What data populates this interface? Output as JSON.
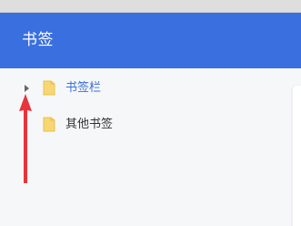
{
  "header": {
    "title": "书签"
  },
  "tree": {
    "items": [
      {
        "label": "书签栏",
        "expandable": true,
        "selected": true,
        "icon": "folder-icon"
      },
      {
        "label": "其他书签",
        "expandable": false,
        "selected": false,
        "icon": "folder-icon"
      }
    ]
  },
  "colors": {
    "accent": "#3a6fe0",
    "header_bg": "#3a6fe0",
    "folder": "#f7d774",
    "annotation_arrow": "#e8343a",
    "sidebar_bg": "#f6f7f9"
  }
}
